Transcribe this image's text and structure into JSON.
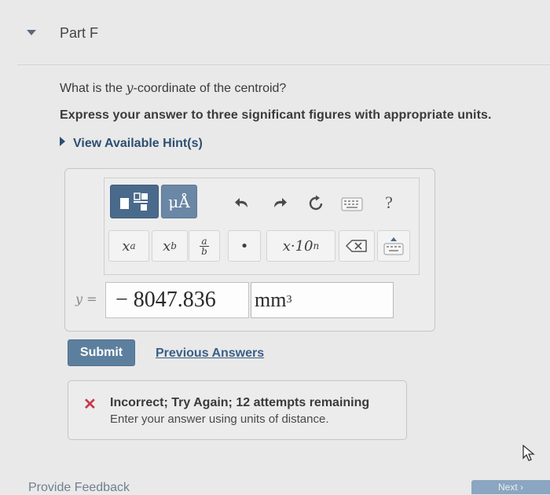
{
  "part": {
    "title": "Part F"
  },
  "question": {
    "text_before": "What is the ",
    "variable": "y",
    "text_after": "-coordinate of the centroid?",
    "instructions": "Express your answer to three significant figures with appropriate units.",
    "hint_label": "View Available Hint(s)"
  },
  "toolbar": {
    "units_label": "μÅ",
    "help_label": "?",
    "superscript_label": "x",
    "superscript_exp": "a",
    "subscript_label": "x",
    "subscript_sub": "b",
    "fraction_num": "a",
    "fraction_den": "b",
    "dot_label": "•",
    "sci_label": "x·10",
    "sci_exp": "n"
  },
  "answer": {
    "variable_label": "y =",
    "value": "− 8047.836",
    "units": "mm",
    "units_exp": "3"
  },
  "actions": {
    "submit_label": "Submit",
    "previous_answers_label": "Previous Answers"
  },
  "feedback": {
    "icon": "✕",
    "title": "Incorrect; Try Again; 12 attempts remaining",
    "detail": "Enter your answer using units of distance."
  },
  "footer": {
    "provide_feedback_label": "Provide Feedback",
    "next_label": "Next ›"
  }
}
